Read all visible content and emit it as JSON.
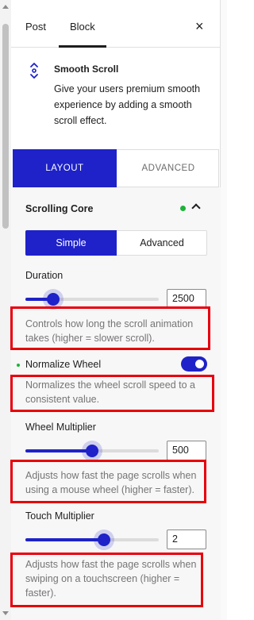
{
  "tabs": {
    "post": "Post",
    "block": "Block",
    "close": "×"
  },
  "block": {
    "icon": "updown-scroll-icon",
    "title": "Smooth Scroll",
    "description": "Give your users premium smooth experience by adding a smooth scroll effect."
  },
  "layout_tabs": {
    "layout": "LAYOUT",
    "advanced": "ADVANCED",
    "active": "LAYOUT"
  },
  "section": {
    "title": "Scrolling Core",
    "status_color": "#1fb23a",
    "expanded": true,
    "mode": {
      "options": [
        "Simple",
        "Advanced"
      ],
      "selected": "Simple"
    }
  },
  "fields": {
    "duration": {
      "label": "Duration",
      "value": "2500",
      "slider_fraction": 0.21,
      "help": "Controls how long the scroll animation takes (higher = slower scroll)."
    },
    "normalize_wheel": {
      "label": "Normalize Wheel",
      "enabled": true,
      "help": "Normalizes the wheel scroll speed to a consistent value."
    },
    "wheel_multiplier": {
      "label": "Wheel Multiplier",
      "value": "500",
      "slider_fraction": 0.5,
      "help": "Adjusts how fast the page scrolls when using a mouse wheel (higher = faster)."
    },
    "touch_multiplier": {
      "label": "Touch Multiplier",
      "value": "2",
      "slider_fraction": 0.59,
      "help": "Adjusts how fast the page scrolls when swiping on a touchscreen (higher = faster)."
    }
  },
  "colors": {
    "accent": "#1e22c8",
    "highlight": "#e8000b",
    "active_dot": "#1fb23a"
  }
}
